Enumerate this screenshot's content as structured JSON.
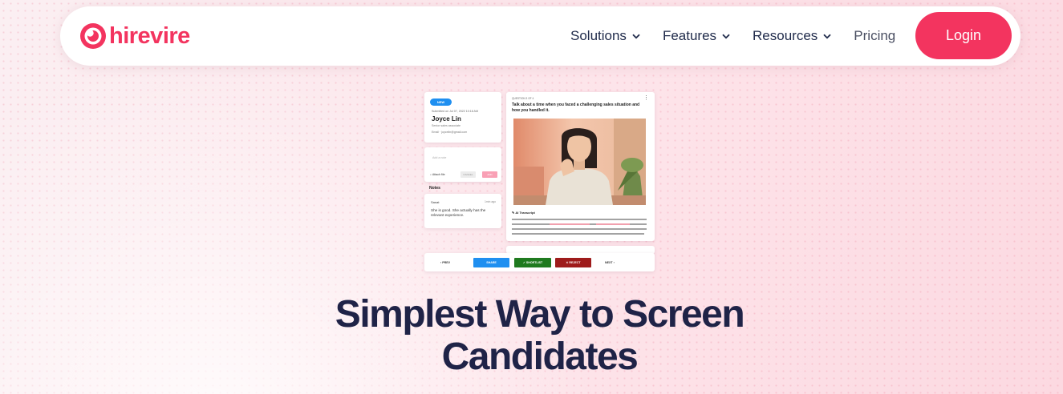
{
  "brand": {
    "name": "hirevire",
    "color": "#f3345f"
  },
  "nav": {
    "items": [
      {
        "label": "Solutions",
        "icon": "chevron-down-icon"
      },
      {
        "label": "Features",
        "icon": "chevron-down-icon"
      },
      {
        "label": "Resources",
        "icon": "chevron-down-icon"
      },
      {
        "label": "Pricing"
      }
    ],
    "login_label": "Login"
  },
  "mockup": {
    "profile": {
      "badge": "NEW",
      "submitted": "Submitted on Jul 07, 2022 10:18 AM",
      "name": "Joyce Lin",
      "role": "Senior sales associate",
      "email": "Email  ·  joycelin@gmail.com"
    },
    "note_input": {
      "placeholder": "Add a note",
      "attach_label": "Attach file",
      "cancel_label": "CANCEL",
      "add_label": "ADD"
    },
    "notes": {
      "title": "Notes",
      "author": "Sanat",
      "time": "1min ago",
      "text": "She is good. She actually has the relevant experience."
    },
    "question": {
      "number": "QUESTION 3 OF 4",
      "text": "Talk about a time when you faced a challenging sales situation and how you handled it.",
      "transcript_label": "AI Transcript"
    },
    "actions": {
      "prev": "‹ PREV",
      "share": "SHARE",
      "shortlist": "✓ SHORTLIST",
      "reject": "✕ REJECT",
      "next": "NEXT ›"
    }
  },
  "hero": {
    "line1": "Simplest Way to Screen",
    "line2": "Candidates"
  },
  "colors": {
    "accent": "#f3345f",
    "navy": "#1f2347",
    "share": "#1f8ff0",
    "shortlist": "#1f7a1f",
    "reject": "#9e1b1b"
  }
}
